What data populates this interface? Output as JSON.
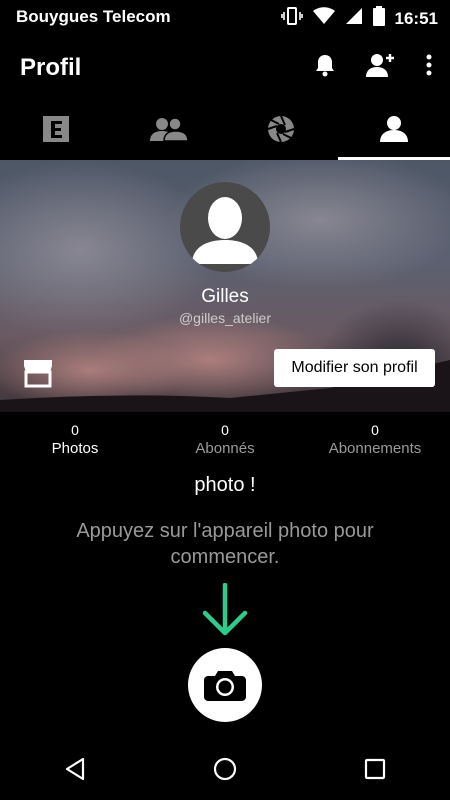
{
  "status_bar": {
    "carrier": "Bouygues Telecom",
    "time": "16:51"
  },
  "app_bar": {
    "title": "Profil"
  },
  "tabs": [
    {
      "icon": "editorial-e-icon",
      "active": false
    },
    {
      "icon": "friends-icon",
      "active": false
    },
    {
      "icon": "aperture-icon",
      "active": false
    },
    {
      "icon": "profile-icon",
      "active": true
    }
  ],
  "profile": {
    "name": "Gilles",
    "handle": "@gilles_atelier",
    "edit_label": "Modifier son profil"
  },
  "stats": [
    {
      "value": "0",
      "label": "Photos",
      "highlight": "#ffffff"
    },
    {
      "value": "0",
      "label": "Abonnés",
      "highlight": "#9a9a9a"
    },
    {
      "value": "0",
      "label": "Abonnements",
      "highlight": "#9a9a9a"
    }
  ],
  "empty_state": {
    "heading": "photo !",
    "hint": "Appuyez sur l'appareil photo pour commencer."
  },
  "colors": {
    "accent": "#2ecc8a",
    "background": "#000000",
    "muted": "#999999"
  }
}
